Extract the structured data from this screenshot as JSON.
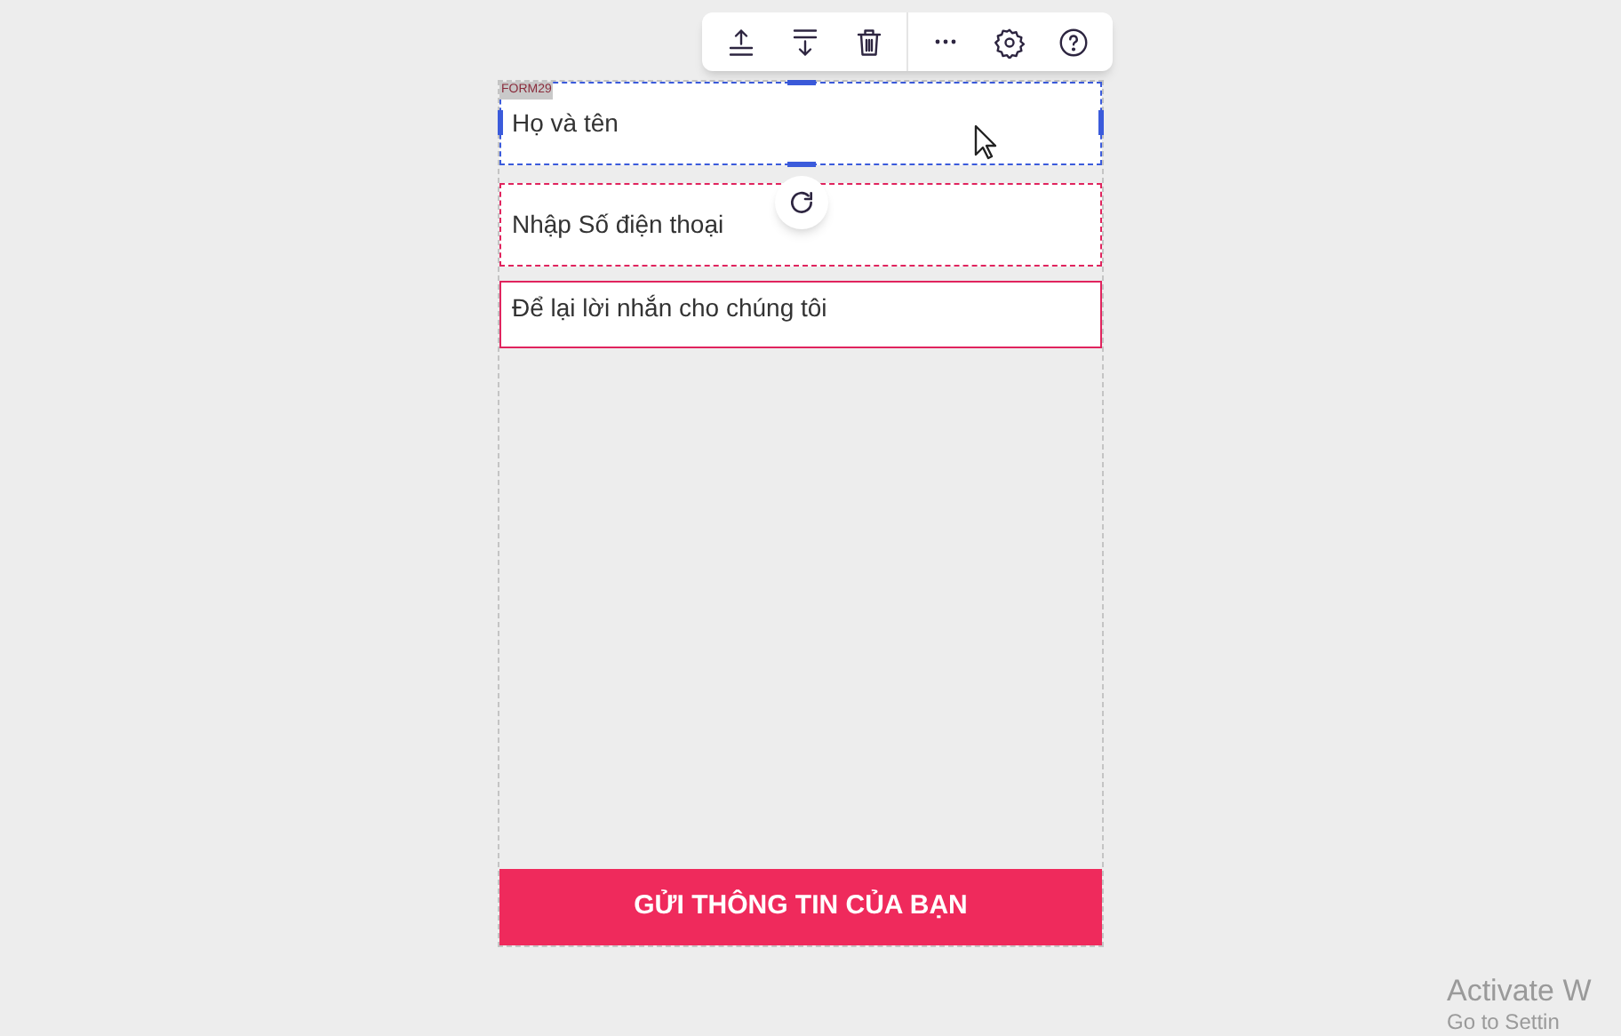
{
  "toolbar": {
    "items": [
      {
        "kind": "move-up"
      },
      {
        "kind": "move-down"
      },
      {
        "kind": "delete"
      },
      {
        "kind": "more"
      },
      {
        "kind": "settings"
      },
      {
        "kind": "help"
      }
    ]
  },
  "form": {
    "tag": "FORM29",
    "fields": [
      {
        "kind": "input",
        "placeholder": "Họ và tên",
        "selected": true
      },
      {
        "kind": "input",
        "placeholder": "Nhập Số điện thoại",
        "selected": false
      },
      {
        "kind": "textarea",
        "placeholder": "Để lại lời nhắn cho chúng tôi",
        "selected": false
      }
    ],
    "submit": "GỬI THÔNG TIN CỦA BẠN"
  },
  "activation": {
    "title": "Activate W",
    "subtitle": "Go to Settin"
  }
}
